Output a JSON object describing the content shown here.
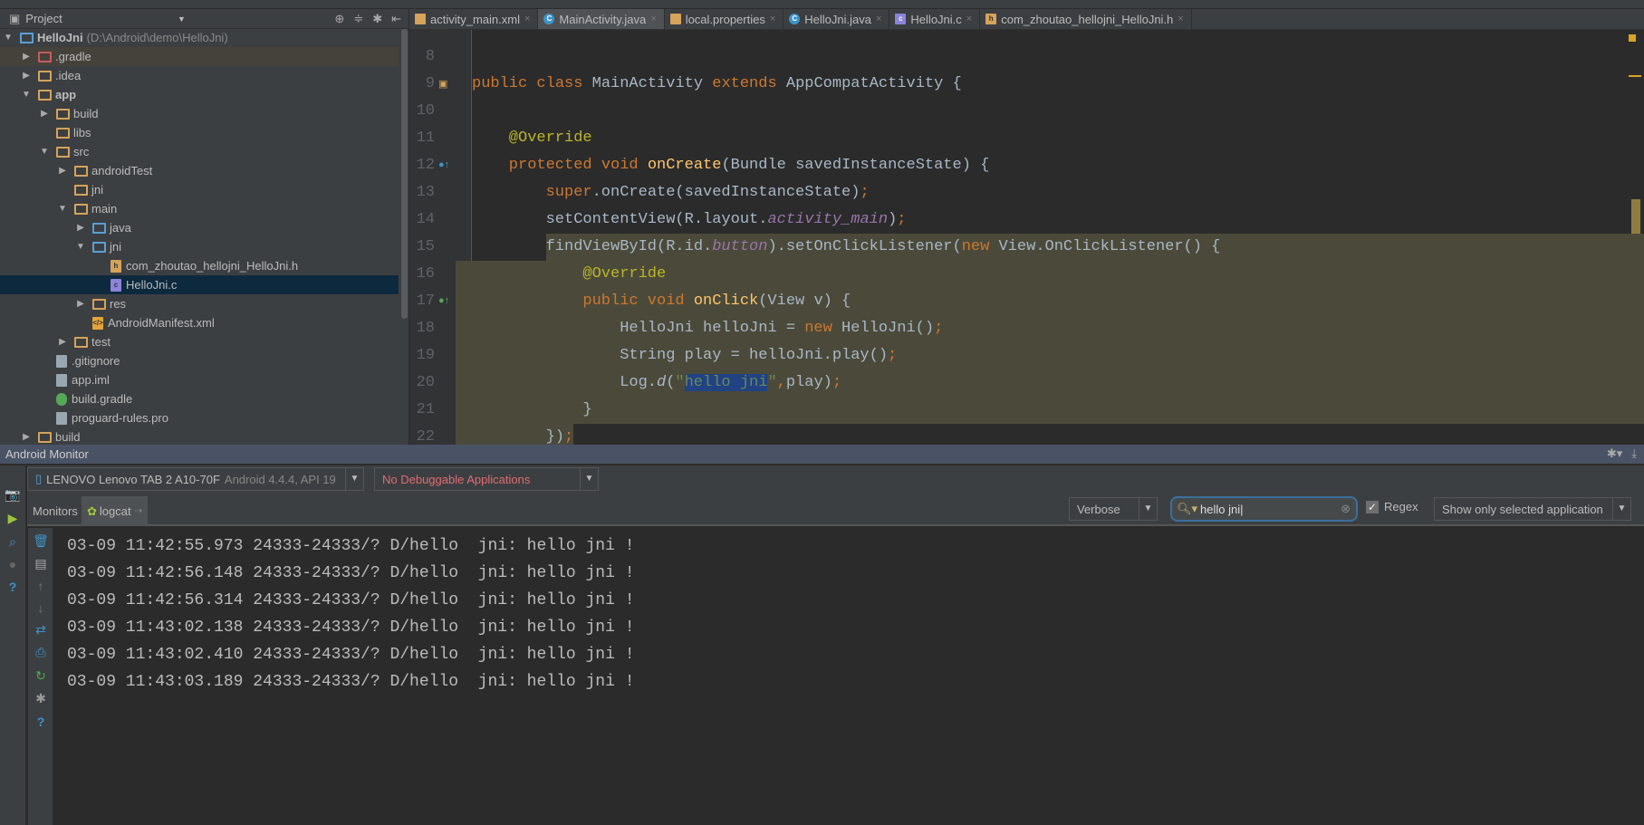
{
  "project_panel": {
    "title": "Project",
    "root": "HelloJni",
    "root_path": "(D:\\Android\\demo\\HelloJni)",
    "items": [
      {
        "label": ".gradle",
        "depth": 1,
        "arrow": "collapsed",
        "icon": "folder-red",
        "state": "hover"
      },
      {
        "label": ".idea",
        "depth": 1,
        "arrow": "collapsed",
        "icon": "folder"
      },
      {
        "label": "app",
        "depth": 1,
        "arrow": "expanded",
        "icon": "module",
        "bold": true
      },
      {
        "label": "build",
        "depth": 2,
        "arrow": "collapsed",
        "icon": "folder"
      },
      {
        "label": "libs",
        "depth": 2,
        "arrow": "none",
        "icon": "folder"
      },
      {
        "label": "src",
        "depth": 2,
        "arrow": "expanded",
        "icon": "folder"
      },
      {
        "label": "androidTest",
        "depth": 3,
        "arrow": "collapsed",
        "icon": "folder"
      },
      {
        "label": "jni",
        "depth": 3,
        "arrow": "none",
        "icon": "folder"
      },
      {
        "label": "main",
        "depth": 3,
        "arrow": "expanded",
        "icon": "folder"
      },
      {
        "label": "java",
        "depth": 4,
        "arrow": "collapsed",
        "icon": "folder-blue"
      },
      {
        "label": "jni",
        "depth": 4,
        "arrow": "expanded",
        "icon": "folder-blue"
      },
      {
        "label": "com_zhoutao_hellojni_HelloJni.h",
        "depth": 5,
        "arrow": "none",
        "icon": "file-h"
      },
      {
        "label": "HelloJni.c",
        "depth": 5,
        "arrow": "none",
        "icon": "file-c",
        "state": "selected"
      },
      {
        "label": "res",
        "depth": 4,
        "arrow": "collapsed",
        "icon": "folder"
      },
      {
        "label": "AndroidManifest.xml",
        "depth": 4,
        "arrow": "none",
        "icon": "file-xml"
      },
      {
        "label": "test",
        "depth": 3,
        "arrow": "collapsed",
        "icon": "folder"
      },
      {
        "label": ".gitignore",
        "depth": 2,
        "arrow": "none",
        "icon": "file"
      },
      {
        "label": "app.iml",
        "depth": 2,
        "arrow": "none",
        "icon": "file"
      },
      {
        "label": "build.gradle",
        "depth": 2,
        "arrow": "none",
        "icon": "file-gradle"
      },
      {
        "label": "proguard-rules.pro",
        "depth": 2,
        "arrow": "none",
        "icon": "file"
      },
      {
        "label": "build",
        "depth": 1,
        "arrow": "collapsed",
        "icon": "folder"
      }
    ]
  },
  "editor": {
    "tabs": [
      {
        "label": "activity_main.xml",
        "icon": "xml-icon"
      },
      {
        "label": "MainActivity.java",
        "icon": "class-icon",
        "active": true
      },
      {
        "label": "local.properties",
        "icon": "properties-icon"
      },
      {
        "label": "HelloJni.java",
        "icon": "class-icon"
      },
      {
        "label": "HelloJni.c",
        "icon": "c-file-icon"
      },
      {
        "label": "com_zhoutao_hellojni_HelloJni.h",
        "icon": "header-file-icon"
      }
    ],
    "lines": [
      {
        "n": "8",
        "indent": 0,
        "tokens": []
      },
      {
        "n": "9",
        "indent": 0,
        "tokens": [
          [
            "public class ",
            "kw"
          ],
          [
            "MainActivity ",
            ""
          ],
          [
            "extends ",
            "kw"
          ],
          [
            "AppCompatActivity {",
            ""
          ]
        ]
      },
      {
        "n": "10",
        "indent": 0,
        "tokens": []
      },
      {
        "n": "11",
        "indent": 1,
        "tokens": [
          [
            "@Override",
            "an"
          ]
        ]
      },
      {
        "n": "12",
        "indent": 1,
        "tokens": [
          [
            "protected void ",
            "kw"
          ],
          [
            "onCreate",
            "mt"
          ],
          [
            "(Bundle savedInstanceState) {",
            ""
          ]
        ]
      },
      {
        "n": "13",
        "indent": 2,
        "tokens": [
          [
            "super",
            "kw"
          ],
          [
            ".onCreate(savedInstanceState)",
            ""
          ],
          [
            ";",
            "kw"
          ]
        ]
      },
      {
        "n": "14",
        "indent": 2,
        "tokens": [
          [
            "setContentView(R.layout.",
            ""
          ],
          [
            "activity_main",
            "fd"
          ],
          [
            ")",
            ""
          ],
          [
            ";",
            "kw"
          ]
        ]
      },
      {
        "n": "15",
        "indent": 2,
        "tokens": [
          [
            "findViewById(R.id.",
            ""
          ],
          [
            "button",
            "fd"
          ],
          [
            ").setOnClickListener(",
            ""
          ],
          [
            "new ",
            "kw"
          ],
          [
            "View.OnClickListener() {",
            ""
          ]
        ]
      },
      {
        "n": "16",
        "indent": 3,
        "tokens": [
          [
            "@Override",
            "an"
          ]
        ]
      },
      {
        "n": "17",
        "indent": 3,
        "tokens": [
          [
            "public void ",
            "kw"
          ],
          [
            "onClick",
            "mt"
          ],
          [
            "(View v) {",
            ""
          ]
        ]
      },
      {
        "n": "18",
        "indent": 4,
        "tokens": [
          [
            "HelloJni helloJni = ",
            ""
          ],
          [
            "new ",
            "kw"
          ],
          [
            "HelloJni()",
            ""
          ],
          [
            ";",
            "kw"
          ]
        ]
      },
      {
        "n": "19",
        "indent": 4,
        "tokens": [
          [
            "String play = helloJni.play()",
            ""
          ],
          [
            ";",
            "kw"
          ]
        ]
      },
      {
        "n": "20",
        "indent": 4,
        "tokens": [
          [
            "Log.",
            ""
          ],
          [
            "d",
            "it"
          ],
          [
            "(",
            ""
          ],
          [
            "\"",
            "st"
          ],
          [
            "hello jni",
            "st sel"
          ],
          [
            "\"",
            "st"
          ],
          [
            ",",
            "kw"
          ],
          [
            "play)",
            ""
          ],
          [
            ";",
            "kw"
          ]
        ]
      },
      {
        "n": "21",
        "indent": 3,
        "tokens": [
          [
            "}",
            ""
          ]
        ]
      },
      {
        "n": "22",
        "indent": 2,
        "tokens": [
          [
            "})",
            ""
          ],
          [
            ";",
            "kw"
          ]
        ]
      }
    ]
  },
  "android_monitor": {
    "title": "Android Monitor",
    "device": "LENOVO Lenovo TAB 2 A10-70F",
    "device_detail": "Android 4.4.4, API 19",
    "app": "No Debuggable Applications",
    "tabs": [
      "Monitors",
      "logcat"
    ],
    "log_level": "Verbose",
    "search_value": "hello jni",
    "regex_label": "Regex",
    "regex_checked": true,
    "filter": "Show only selected application",
    "log_lines": [
      "03-09 11:42:55.973 24333-24333/? D/hello  jni: hello jni !",
      "03-09 11:42:56.148 24333-24333/? D/hello  jni: hello jni !",
      "03-09 11:42:56.314 24333-24333/? D/hello  jni: hello jni !",
      "03-09 11:43:02.138 24333-24333/? D/hello  jni: hello jni !",
      "03-09 11:43:02.410 24333-24333/? D/hello  jni: hello jni !",
      "03-09 11:43:03.189 24333-24333/? D/hello  jni: hello jni !"
    ]
  },
  "colors": {
    "keyword": "#cc7832",
    "method": "#ffc66d",
    "annotation": "#bbb529",
    "string": "#6a8759",
    "field": "#9876aa",
    "error": "#e06c75",
    "selection": "#0d293e"
  }
}
